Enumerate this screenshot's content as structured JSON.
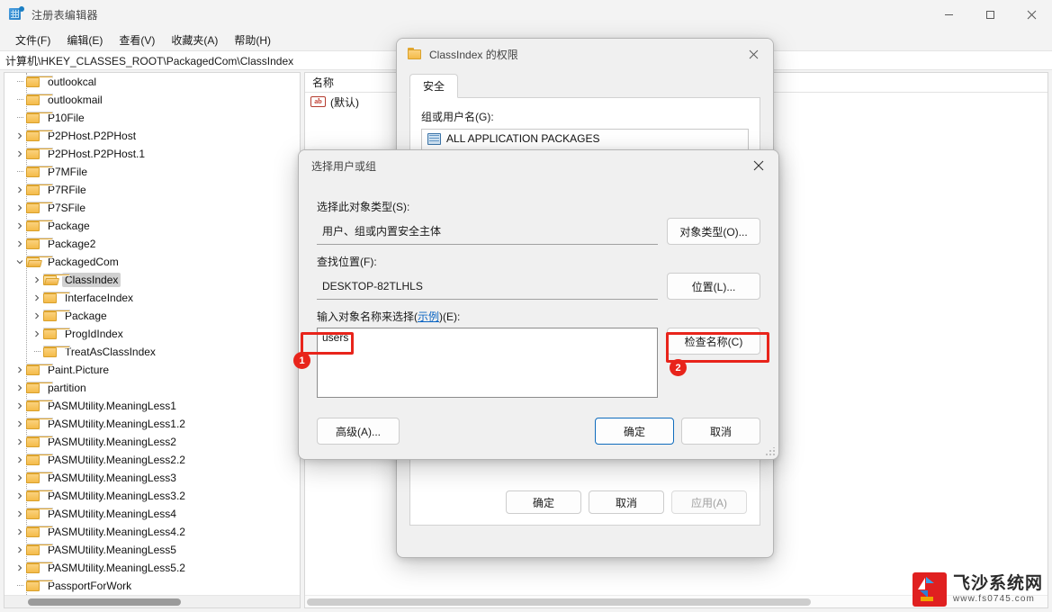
{
  "window": {
    "title": "注册表编辑器",
    "icon": "registry-editor-icon",
    "controls": {
      "minimize": "minimize-icon",
      "maximize": "maximize-icon",
      "close": "close-icon"
    }
  },
  "menubar": {
    "items": [
      {
        "label": "文件(F)"
      },
      {
        "label": "编辑(E)"
      },
      {
        "label": "查看(V)"
      },
      {
        "label": "收藏夹(A)"
      },
      {
        "label": "帮助(H)"
      }
    ]
  },
  "addressbar": {
    "path": "计算机\\HKEY_CLASSES_ROOT\\PackagedCom\\ClassIndex"
  },
  "tree": {
    "items": [
      {
        "label": "outlookcal",
        "indent": 1,
        "arrow": "none",
        "open": false,
        "selected": false
      },
      {
        "label": "outlookmail",
        "indent": 1,
        "arrow": "none",
        "open": false,
        "selected": false
      },
      {
        "label": "P10File",
        "indent": 1,
        "arrow": "none",
        "open": false,
        "selected": false
      },
      {
        "label": "P2PHost.P2PHost",
        "indent": 1,
        "arrow": "collapsed",
        "open": false,
        "selected": false
      },
      {
        "label": "P2PHost.P2PHost.1",
        "indent": 1,
        "arrow": "collapsed",
        "open": false,
        "selected": false
      },
      {
        "label": "P7MFile",
        "indent": 1,
        "arrow": "none",
        "open": false,
        "selected": false
      },
      {
        "label": "P7RFile",
        "indent": 1,
        "arrow": "collapsed",
        "open": false,
        "selected": false
      },
      {
        "label": "P7SFile",
        "indent": 1,
        "arrow": "collapsed",
        "open": false,
        "selected": false
      },
      {
        "label": "Package",
        "indent": 1,
        "arrow": "collapsed",
        "open": false,
        "selected": false
      },
      {
        "label": "Package2",
        "indent": 1,
        "arrow": "collapsed",
        "open": false,
        "selected": false
      },
      {
        "label": "PackagedCom",
        "indent": 1,
        "arrow": "expanded",
        "open": true,
        "selected": false
      },
      {
        "label": "ClassIndex",
        "indent": 2,
        "arrow": "collapsed",
        "open": true,
        "selected": true
      },
      {
        "label": "InterfaceIndex",
        "indent": 2,
        "arrow": "collapsed",
        "open": false,
        "selected": false
      },
      {
        "label": "Package",
        "indent": 2,
        "arrow": "collapsed",
        "open": false,
        "selected": false
      },
      {
        "label": "ProgIdIndex",
        "indent": 2,
        "arrow": "collapsed",
        "open": false,
        "selected": false
      },
      {
        "label": "TreatAsClassIndex",
        "indent": 2,
        "arrow": "none",
        "open": false,
        "selected": false
      },
      {
        "label": "Paint.Picture",
        "indent": 1,
        "arrow": "collapsed",
        "open": false,
        "selected": false
      },
      {
        "label": "partition",
        "indent": 1,
        "arrow": "collapsed",
        "open": false,
        "selected": false
      },
      {
        "label": "PASMUtility.MeaningLess1",
        "indent": 1,
        "arrow": "collapsed",
        "open": false,
        "selected": false
      },
      {
        "label": "PASMUtility.MeaningLess1.2",
        "indent": 1,
        "arrow": "collapsed",
        "open": false,
        "selected": false
      },
      {
        "label": "PASMUtility.MeaningLess2",
        "indent": 1,
        "arrow": "collapsed",
        "open": false,
        "selected": false
      },
      {
        "label": "PASMUtility.MeaningLess2.2",
        "indent": 1,
        "arrow": "collapsed",
        "open": false,
        "selected": false
      },
      {
        "label": "PASMUtility.MeaningLess3",
        "indent": 1,
        "arrow": "collapsed",
        "open": false,
        "selected": false
      },
      {
        "label": "PASMUtility.MeaningLess3.2",
        "indent": 1,
        "arrow": "collapsed",
        "open": false,
        "selected": false
      },
      {
        "label": "PASMUtility.MeaningLess4",
        "indent": 1,
        "arrow": "collapsed",
        "open": false,
        "selected": false
      },
      {
        "label": "PASMUtility.MeaningLess4.2",
        "indent": 1,
        "arrow": "collapsed",
        "open": false,
        "selected": false
      },
      {
        "label": "PASMUtility.MeaningLess5",
        "indent": 1,
        "arrow": "collapsed",
        "open": false,
        "selected": false
      },
      {
        "label": "PASMUtility.MeaningLess5.2",
        "indent": 1,
        "arrow": "collapsed",
        "open": false,
        "selected": false
      },
      {
        "label": "PassportForWork",
        "indent": 1,
        "arrow": "none",
        "open": false,
        "selected": false
      }
    ]
  },
  "list": {
    "columns": [
      "名称"
    ],
    "rows": [
      {
        "icon": "string-value-icon",
        "name": "(默认)"
      }
    ]
  },
  "permissions_dialog": {
    "title": "ClassIndex 的权限",
    "icon": "folder-icon",
    "close": "close-icon",
    "tabs": [
      {
        "label": "安全",
        "active": true
      }
    ],
    "group_label": "组或用户名(G):",
    "group_items": [
      {
        "name": "ALL APPLICATION PACKAGES",
        "icon": "user-group-icon"
      }
    ],
    "footer_buttons": [
      {
        "label": "确定",
        "state": "normal"
      },
      {
        "label": "取消",
        "state": "normal"
      },
      {
        "label": "应用(A)",
        "state": "disabled"
      }
    ]
  },
  "select_dialog": {
    "title": "选择用户或组",
    "close": "close-icon",
    "object_type_label": "选择此对象类型(S):",
    "object_type_value": "用户、组或内置安全主体",
    "object_type_button": "对象类型(O)...",
    "location_label": "查找位置(F):",
    "location_value": "DESKTOP-82TLHLS",
    "location_button": "位置(L)...",
    "names_label_prefix": "输入对象名称来选择(",
    "names_label_link": "示例",
    "names_label_suffix": ")(E):",
    "names_value": "users",
    "check_names_button": "检查名称(C)",
    "advanced_button": "高级(A)...",
    "ok_button": "确定",
    "cancel_button": "取消"
  },
  "annotations": [
    {
      "badge": "1",
      "target": "names-textarea"
    },
    {
      "badge": "2",
      "target": "check-names-button"
    }
  ],
  "watermark": {
    "name": "飞沙系统网",
    "url": "www.fs0745.com"
  },
  "colors": {
    "accent": "#0f6cbd",
    "annotation": "#e8241b",
    "link": "#0a64c2",
    "folder": "#f4bb4a"
  }
}
